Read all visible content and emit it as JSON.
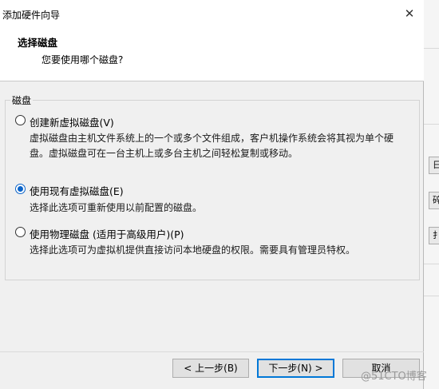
{
  "dialog": {
    "title": "添加硬件向导",
    "close_glyph": "✕"
  },
  "header": {
    "title": "选择磁盘",
    "subtitle": "您要使用哪个磁盘?"
  },
  "disk_group": {
    "legend": "磁盘",
    "options": [
      {
        "label": "创建新虚拟磁盘(V)",
        "description": "虚拟磁盘由主机文件系统上的一个或多个文件组成，客户机操作系统会将其视为单个硬盘。虚拟磁盘可在一台主机上或多台主机之间轻松复制或移动。",
        "checked": false
      },
      {
        "label": "使用现有虚拟磁盘(E)",
        "description": "选择此选项可重新使用以前配置的磁盘。",
        "checked": true
      },
      {
        "label": "使用物理磁盘 (适用于高级用户)(P)",
        "description": "选择此选项可为虚拟机提供直接访问本地硬盘的权限。需要具有管理员特权。",
        "checked": false
      }
    ]
  },
  "footer": {
    "back_label": "< 上一步(B)",
    "next_label": "下一步(N) >",
    "cancel_label": "取消"
  },
  "background_window": {
    "button_labels": [
      "日",
      "碎",
      "扌"
    ]
  },
  "watermark": "@51CTO博客",
  "colors": {
    "accent": "#0a63c9",
    "focus_border": "#0078d7"
  }
}
